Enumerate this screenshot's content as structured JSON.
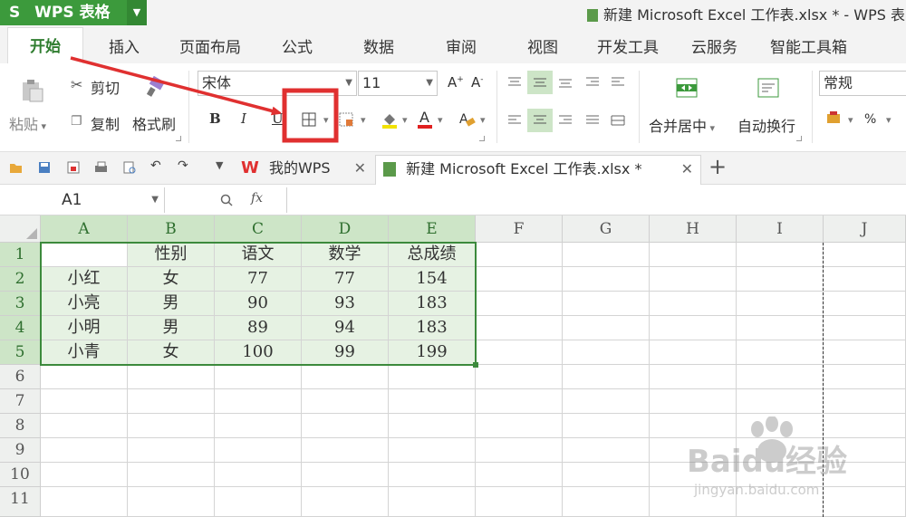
{
  "app": {
    "name": "WPS 表格",
    "logo": "S"
  },
  "window_title": "新建 Microsoft Excel 工作表.xlsx * - WPS 表",
  "ribbon_tabs": [
    "开始",
    "插入",
    "页面布局",
    "公式",
    "数据",
    "审阅",
    "视图",
    "开发工具",
    "云服务",
    "智能工具箱"
  ],
  "ribbon": {
    "paste": "粘贴",
    "cut": "剪切",
    "copy": "复制",
    "format_painter": "格式刷",
    "font_name": "宋体",
    "font_size": "11",
    "bold": "B",
    "italic": "I",
    "underline": "U",
    "merge_center": "合并居中",
    "wrap_text": "自动换行",
    "number_format": "常规",
    "percent": "%"
  },
  "doc_tabs": [
    {
      "label": "我的WPS"
    },
    {
      "label": "新建 Microsoft Excel 工作表.xlsx *"
    }
  ],
  "formula_bar": {
    "name_box": "A1",
    "fx": "fx"
  },
  "sheet": {
    "columns": [
      "A",
      "B",
      "C",
      "D",
      "E",
      "F",
      "G",
      "H",
      "I",
      "J"
    ],
    "rows": [
      "1",
      "2",
      "3",
      "4",
      "5",
      "6",
      "7",
      "8",
      "9",
      "10",
      "11"
    ],
    "header_row": [
      "",
      "性别",
      "语文",
      "数学",
      "总成绩"
    ],
    "data_rows": [
      [
        "小红",
        "女",
        "77",
        "77",
        "154"
      ],
      [
        "小亮",
        "男",
        "90",
        "93",
        "183"
      ],
      [
        "小明",
        "男",
        "89",
        "94",
        "183"
      ],
      [
        "小青",
        "女",
        "100",
        "99",
        "199"
      ]
    ]
  },
  "annotation": {
    "arrow_color": "#e03030",
    "highlight_color": "#e03030",
    "target": "border-icon"
  },
  "watermark": {
    "brand": "Baidu经验",
    "url": "jingyan.baidu.com"
  }
}
